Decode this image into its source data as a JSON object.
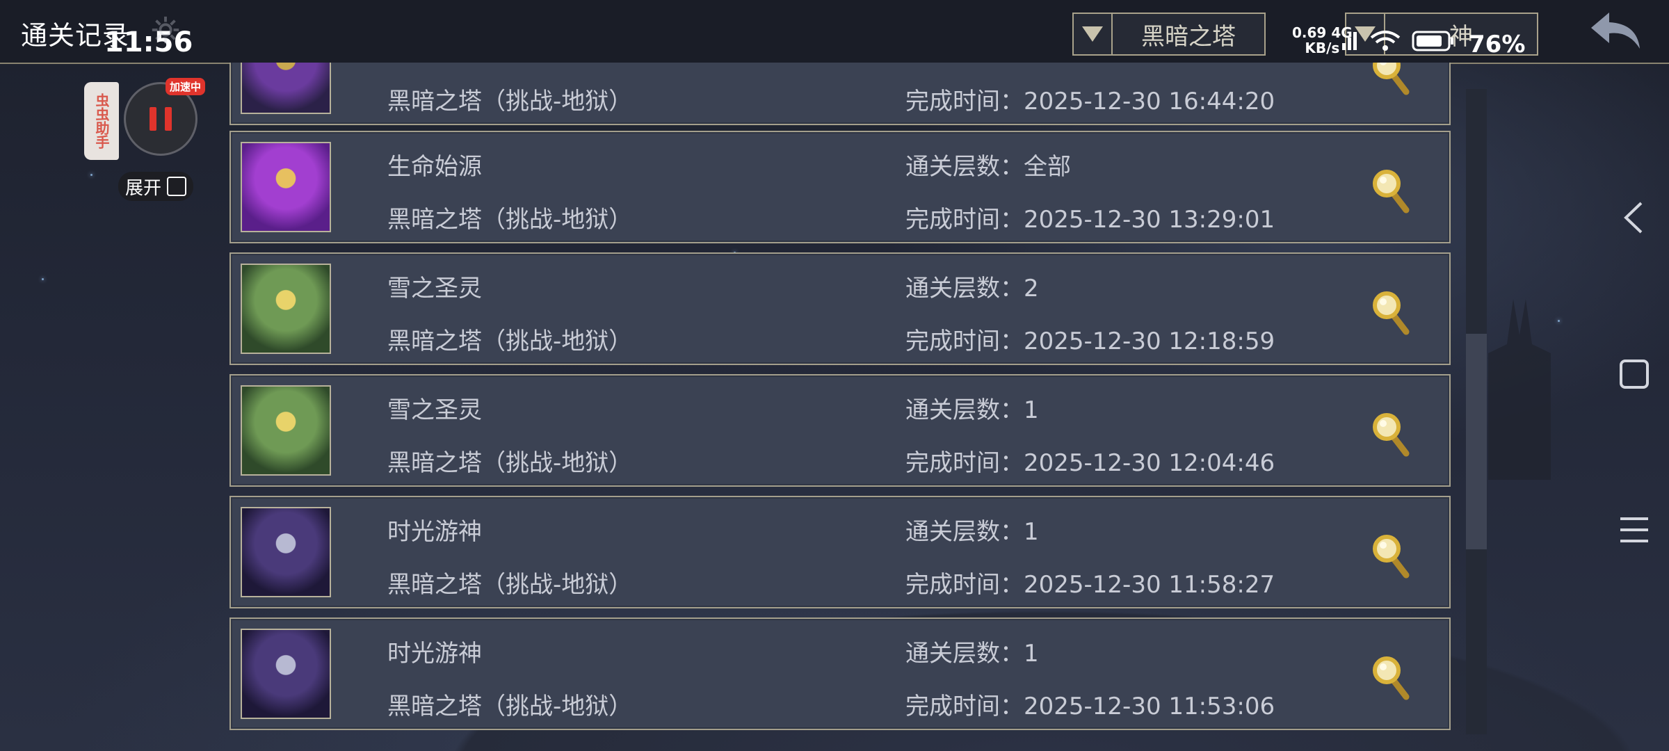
{
  "page": {
    "title": "通关记录",
    "status_time": "11:56"
  },
  "filters": {
    "tower": "黑暗之塔",
    "rank": "神"
  },
  "status_bar": {
    "net_speed": "0.69",
    "net_unit": "KB/s",
    "net_type": "4G",
    "battery": "76%"
  },
  "assistant": {
    "tab_label": "虫虫助手",
    "badge": "加速中",
    "expand_label": "展开"
  },
  "records": [
    {
      "name": "",
      "tower": "黑暗之塔（挑战-地狱）",
      "floors_label": "通关层数：",
      "floors": "",
      "time_label": "完成时间：",
      "time": "2025-12-30 16:44:20",
      "avatar": "purple-hero"
    },
    {
      "name": "生命始源",
      "tower": "黑暗之塔（挑战-地狱）",
      "floors_label": "通关层数：",
      "floors": "全部",
      "time_label": "完成时间：",
      "time": "2025-12-30 13:29:01",
      "avatar": "violet-sorceress"
    },
    {
      "name": "雪之圣灵",
      "tower": "黑暗之塔（挑战-地狱）",
      "floors_label": "通关层数：",
      "floors": "2",
      "time_label": "完成时间：",
      "time": "2025-12-30 12:18:59",
      "avatar": "green-priestess"
    },
    {
      "name": "雪之圣灵",
      "tower": "黑暗之塔（挑战-地狱）",
      "floors_label": "通关层数：",
      "floors": "1",
      "time_label": "完成时间：",
      "time": "2025-12-30 12:04:46",
      "avatar": "green-priestess"
    },
    {
      "name": "时光游神",
      "tower": "黑暗之塔（挑战-地狱）",
      "floors_label": "通关层数：",
      "floors": "1",
      "time_label": "完成时间：",
      "time": "2025-12-30 11:58:27",
      "avatar": "silver-timekeeper"
    },
    {
      "name": "时光游神",
      "tower": "黑暗之塔（挑战-地狱）",
      "floors_label": "通关层数：",
      "floors": "1",
      "time_label": "完成时间：",
      "time": "2025-12-30 11:53:06",
      "avatar": "silver-timekeeper"
    }
  ],
  "colors": {
    "panel": "#3b4253",
    "border": "#a49f8c",
    "accent_gold": "#d9b23a",
    "badge_red": "#e0342c"
  },
  "icons": [
    "gear-icon",
    "wifi-icon",
    "signal-icon",
    "battery-icon",
    "back-arrow-icon",
    "magnifier-icon",
    "nav-back-icon",
    "nav-home-icon",
    "nav-menu-icon",
    "dropdown-arrow-icon"
  ]
}
